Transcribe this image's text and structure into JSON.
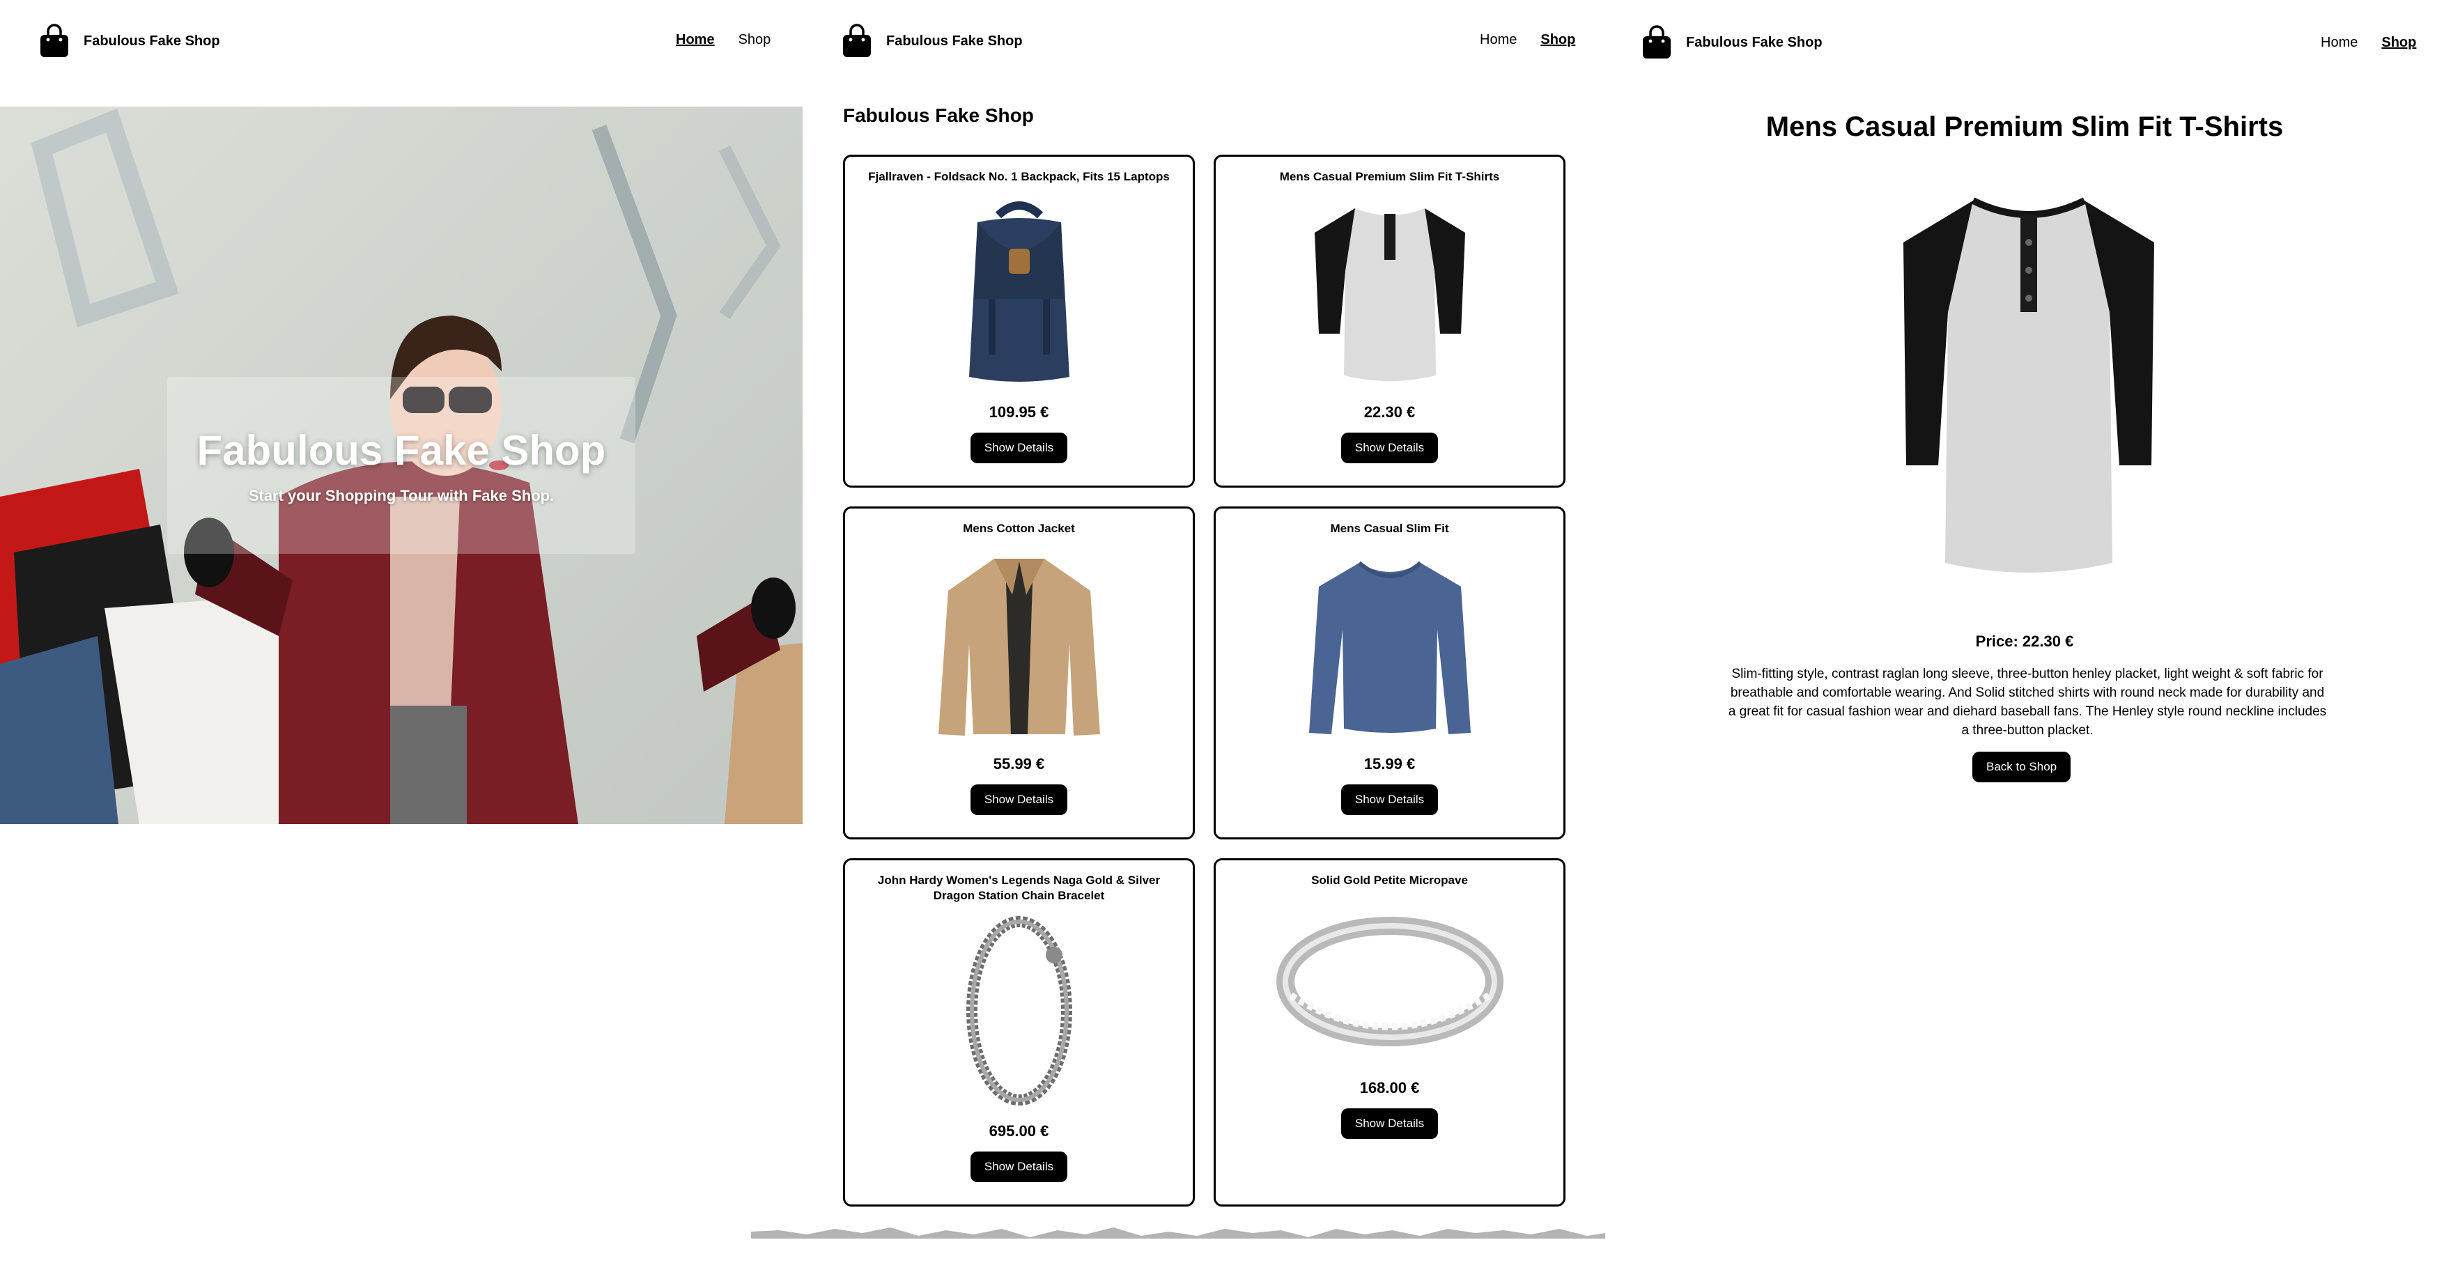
{
  "brand": {
    "name": "Fabulous Fake Shop",
    "icon": "shopping-bag-icon"
  },
  "nav": {
    "home": "Home",
    "shop": "Shop"
  },
  "hero": {
    "title": "Fabulous Fake Shop",
    "subtitle": "Start your Shopping Tour with Fake Shop."
  },
  "shop": {
    "title": "Fabulous Fake Shop",
    "products": [
      {
        "title": "Fjallraven - Foldsack No. 1 Backpack, Fits 15 Laptops",
        "price": "109.95 €",
        "button": "Show Details"
      },
      {
        "title": "Mens Casual Premium Slim Fit T-Shirts",
        "price": "22.30 €",
        "button": "Show Details"
      },
      {
        "title": "Mens Cotton Jacket",
        "price": "55.99 €",
        "button": "Show Details"
      },
      {
        "title": "Mens Casual Slim Fit",
        "price": "15.99 €",
        "button": "Show Details"
      },
      {
        "title": "John Hardy Women's Legends Naga Gold & Silver Dragon Station Chain Bracelet",
        "price": "695.00 €",
        "button": "Show Details"
      },
      {
        "title": "Solid Gold Petite Micropave",
        "price": "168.00 €",
        "button": "Show Details"
      }
    ]
  },
  "detail": {
    "title": "Mens Casual Premium Slim Fit T-Shirts",
    "price": "Price: 22.30 €",
    "description": "Slim-fitting style, contrast raglan long sleeve, three-button henley placket, light weight & soft fabric for breathable and comfortable wearing. And Solid stitched shirts with round neck made for durability and a great fit for casual fashion wear and diehard baseball fans. The Henley style round neckline includes a three-button placket.",
    "back_button": "Back to Shop"
  }
}
